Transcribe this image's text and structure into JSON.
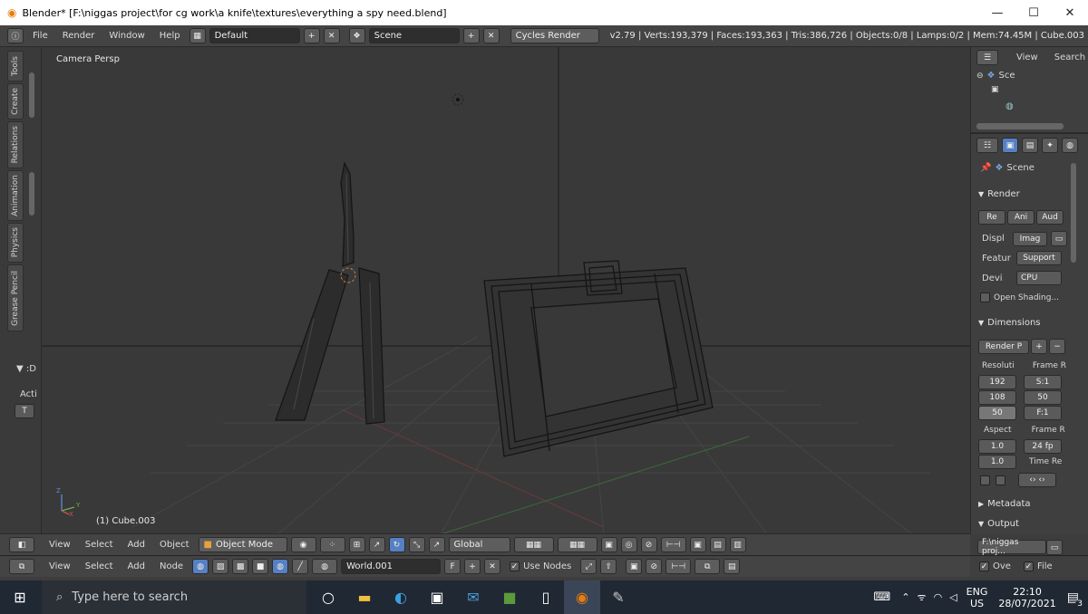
{
  "window": {
    "title": "Blender* [F:\\niggas project\\for cg work\\a knife\\textures\\everything a spy need.blend]",
    "minimize": "—",
    "maximize": "☐",
    "close": "✕"
  },
  "info_header": {
    "menus": [
      "File",
      "Render",
      "Window",
      "Help"
    ],
    "layout": "Default",
    "scene": "Scene",
    "engine": "Cycles Render",
    "stats": "v2.79 | Verts:193,379 | Faces:193,363 | Tris:386,726 | Objects:0/8 | Lamps:0/2 | Mem:74.45M | Cube.003"
  },
  "tool_shelf": {
    "tabs": [
      "Tools",
      "Create",
      "Relations",
      "Animation",
      "Physics",
      "Grease Pencil"
    ],
    "section": "▼ :D",
    "acti": "Acti",
    "tool_btn": "T"
  },
  "viewport": {
    "title": "Camera Persp",
    "selected": "(1) Cube.003",
    "axis_x": "X",
    "axis_y": "Y",
    "axis_z": "Z"
  },
  "outliner": {
    "view": "View",
    "search": "Search",
    "scene_item": "Sce"
  },
  "properties": {
    "scene": "Scene",
    "render_panel": "Render",
    "render_buttons": [
      "Re",
      "Ani",
      "Aud"
    ],
    "display_label": "Displ",
    "display_value": "Imag",
    "feature_label": "Featur",
    "feature_value": "Support",
    "device_label": "Devi",
    "device_value": "CPU",
    "open_shading": "Open Shading...",
    "dimensions_panel": "Dimensions",
    "render_preset": "Render P",
    "resolution_label": "Resoluti",
    "frame_range_label": "Frame R",
    "res_x": "192",
    "res_y": "108",
    "res_pct": "50",
    "frame_start": "S:1",
    "frame_end": "50",
    "frame_step": "F:1",
    "aspect_label": "Aspect",
    "frame_rate_label": "Frame R",
    "aspect_x": "1.0",
    "aspect_y": "1.0",
    "fps": "24 fp",
    "time_remap": "Time Re",
    "metadata_panel": "Metadata",
    "output_panel": "Output",
    "output_path": "F:\\niggas proj...",
    "overwrite": "Ove",
    "file_ext": "File"
  },
  "view3d_header": {
    "menus": [
      "View",
      "Select",
      "Add",
      "Object"
    ],
    "mode": "Object Mode",
    "orientation": "Global"
  },
  "node_header": {
    "menus": [
      "View",
      "Select",
      "Add",
      "Node"
    ],
    "world": "World.001",
    "fake_user": "F",
    "use_nodes": "Use Nodes"
  },
  "taskbar": {
    "search_placeholder": "Type here to search",
    "lang_top": "ENG",
    "lang_bottom": "US",
    "time": "22:10",
    "date": "28/07/2021",
    "notifications": "3"
  },
  "colors": {
    "viewport_bg": "#393939",
    "panel_bg": "#3f3f3f",
    "header_bg": "#444444",
    "accent_blue": "#5680c2",
    "taskbar": "#202833"
  }
}
